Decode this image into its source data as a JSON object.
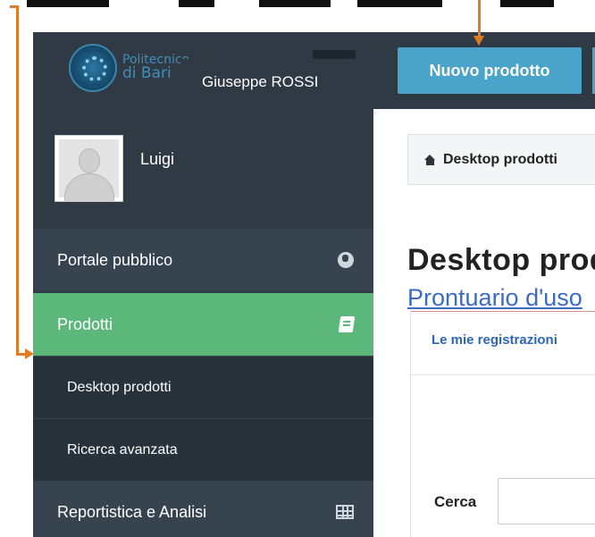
{
  "header": {
    "logo_line1": "Politecnico",
    "logo_line2": "di Bari",
    "new_product_button": "Nuovo prodotto"
  },
  "user": {
    "first_name": "Luigi",
    "full_name_tooltip": "Giuseppe ROSSI"
  },
  "sidebar": {
    "items": [
      {
        "label": "Portale pubblico",
        "icon": "globe-icon"
      },
      {
        "label": "Prodotti",
        "icon": "book-icon",
        "active": true
      },
      {
        "label": "Desktop prodotti"
      },
      {
        "label": "Ricerca avanzata"
      },
      {
        "label": "Reportistica e Analisi",
        "icon": "grid-icon"
      }
    ]
  },
  "main": {
    "breadcrumb": "Desktop prodotti",
    "page_title": "Desktop prodotti",
    "guide_link": "Prontuario d'uso",
    "tab_label": "Le mie registrazioni",
    "search_label": "Cerca",
    "search_value": ""
  },
  "colors": {
    "sidebar_bg": "#2f3a44",
    "active_item": "#5cb87a",
    "primary_button": "#4aa3c8",
    "annotation_arrow": "#e07b24"
  }
}
